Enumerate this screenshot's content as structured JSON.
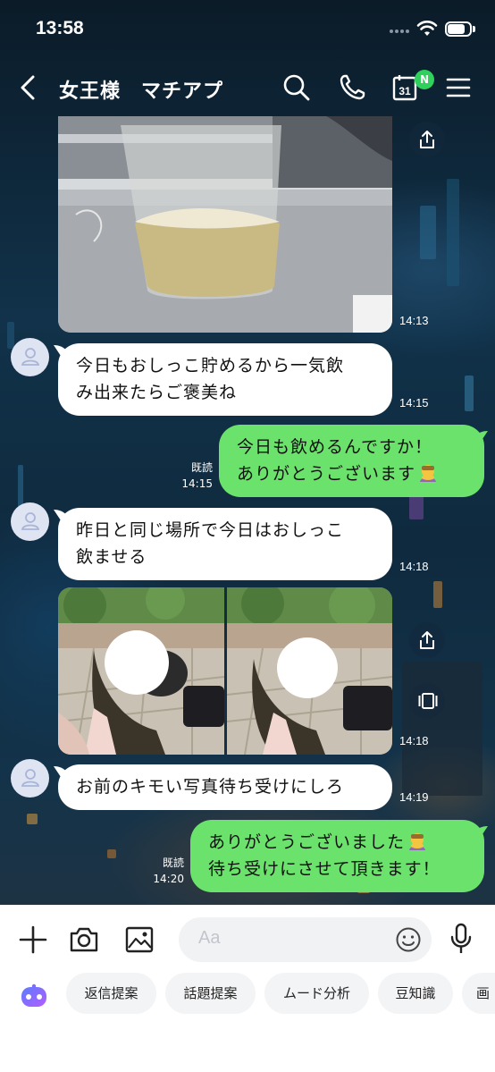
{
  "status_bar": {
    "time": "13:58"
  },
  "header": {
    "title": "女王様　マチアプ",
    "calendar_day": "31",
    "calendar_badge": "N"
  },
  "messages": [
    {
      "type": "photo",
      "direction": "in",
      "time": "14:13"
    },
    {
      "type": "text",
      "direction": "in",
      "lines": [
        "今日もおしっこ貯めるから一気飲",
        "み出来たらご褒美ね"
      ],
      "time": "14:15"
    },
    {
      "type": "text",
      "direction": "out",
      "lines": [
        "今日も飲めるんですか！",
        "ありがとうございます"
      ],
      "read": "既読",
      "time": "14:15"
    },
    {
      "type": "text",
      "direction": "in",
      "lines": [
        "昨日と同じ場所で今日はおしっこ",
        "飲ませる"
      ],
      "time": "14:18"
    },
    {
      "type": "photo",
      "direction": "in",
      "count": 2,
      "time": "14:18"
    },
    {
      "type": "text",
      "direction": "in",
      "lines": [
        "お前のキモい写真待ち受けにしろ"
      ],
      "time": "14:19"
    },
    {
      "type": "text",
      "direction": "out",
      "lines": [
        "ありがとうございました",
        "待ち受けにさせて頂きます！"
      ],
      "read": "既読",
      "time": "14:20"
    }
  ],
  "input": {
    "placeholder": "Aa"
  },
  "suggestions": [
    "返信提案",
    "話題提案",
    "ムード分析",
    "豆知識",
    "画"
  ],
  "colors": {
    "outgoing": "#6be26c",
    "incoming": "#ffffff",
    "badge": "#2fd15c"
  },
  "icons": [
    "back-icon",
    "search-icon",
    "phone-icon",
    "calendar-icon",
    "menu-icon",
    "share-icon",
    "gallery-icon",
    "avatar-icon",
    "plus-icon",
    "camera-icon",
    "image-icon",
    "emoji-icon",
    "mic-icon",
    "ai-assistant-icon"
  ]
}
